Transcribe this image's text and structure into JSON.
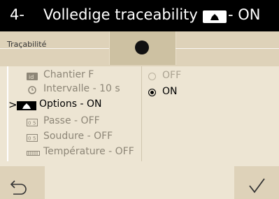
{
  "header": {
    "number": "4-",
    "title": "Volledige traceability",
    "icon": "options-icon",
    "state": "- ON"
  },
  "tab": {
    "label": "Traçabilité",
    "active_indicator": "dot"
  },
  "menu": {
    "items": [
      {
        "label": "Chantier F",
        "icon": "id-card-icon",
        "selected": false
      },
      {
        "label": "Intervalle - 10 s",
        "icon": "clock-icon",
        "selected": false
      },
      {
        "label": "Options - ON",
        "icon": "options-icon",
        "selected": true
      },
      {
        "label": "Passe - OFF",
        "icon": "counter-icon",
        "selected": false
      },
      {
        "label": "Soudure - OFF",
        "icon": "counter-icon",
        "selected": false
      },
      {
        "label": "Température - OFF",
        "icon": "thermometer-icon",
        "selected": false
      }
    ],
    "selected_marker": ">"
  },
  "options": [
    {
      "label": "OFF",
      "checked": false
    },
    {
      "label": "ON",
      "checked": true
    }
  ],
  "buttons": {
    "back": "back-arrow-icon",
    "confirm": "check-icon"
  },
  "colors": {
    "screen_bg": "#ede5d3",
    "panel_bg": "#ded2b9",
    "active_tab_bg": "#cdc1a2",
    "header_bg": "#000000"
  }
}
